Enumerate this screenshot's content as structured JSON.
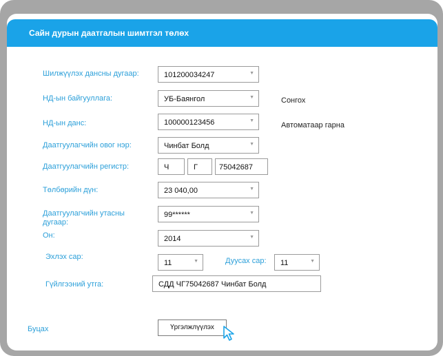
{
  "header": {
    "title": "Сайн дурын даатгалын шимтгэл  төлөх"
  },
  "form": {
    "account": {
      "label": "Шилжүүлэх дансны дугаар:",
      "value": "101200034247"
    },
    "org": {
      "label": "НД-ын байгууллага:",
      "value": "УБ-Баянгол",
      "note": "Сонгох"
    },
    "nd_account": {
      "label": "НД-ын данс:",
      "value": "100000123456",
      "note": "Автоматаар гарна"
    },
    "name": {
      "label": "Даатгуулагчийн овог нэр:",
      "value": "Чинбат Болд"
    },
    "register": {
      "label": "Даатгуулагчийн  регистр:",
      "l1": "Ч",
      "l2": "Г",
      "digits": "75042687"
    },
    "amount": {
      "label": "Төлбөрийн   дүн:",
      "value": "23 040,00"
    },
    "phone": {
      "label_line1": "Даатгуулагчийн  утасны",
      "label_line2": "дугаар:",
      "value": "99******"
    },
    "year": {
      "label": "Он:",
      "value": "2014"
    },
    "start_month": {
      "label": "Эхлэх сар:",
      "value": "11"
    },
    "end_month": {
      "label": "Дуусах сар:",
      "value": "11"
    },
    "description": {
      "label": "Гүйлгээний  утга:",
      "value": "СДД ЧГ75042687 Чинбат Болд"
    }
  },
  "actions": {
    "back_label": "Буцах",
    "continue_label": "Үргэлжлүүлэх"
  },
  "colors": {
    "accent": "#1aa3e8",
    "label": "#2b9fd9",
    "frame": "#a6a6a6"
  },
  "icons": {
    "dropdown": "chevron-down-icon",
    "cursor": "mouse-pointer-icon"
  }
}
